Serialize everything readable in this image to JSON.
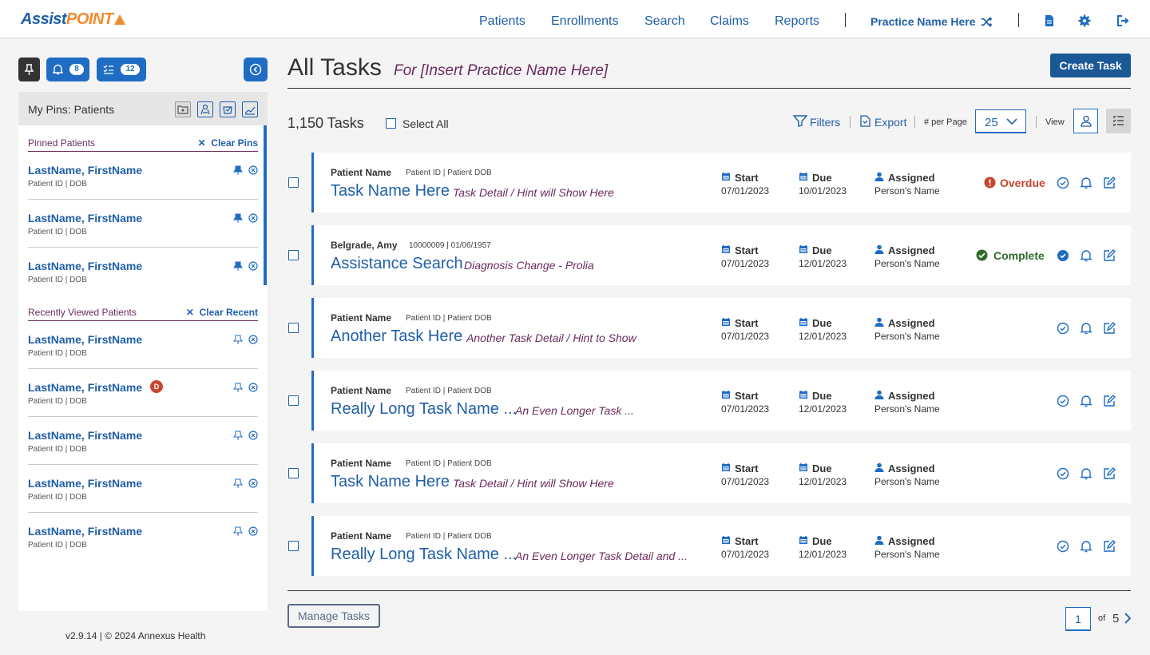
{
  "header": {
    "logo_left": "Assist",
    "logo_right": "POINT",
    "nav": [
      "Patients",
      "Enrollments",
      "Search",
      "Claims",
      "Reports"
    ],
    "practice": "Practice Name Here",
    "icons": [
      "document-icon",
      "gear-icon",
      "logout-icon"
    ]
  },
  "sidebar": {
    "notifications_count": "8",
    "tasks_count": "12",
    "panel_title": "My Pins: Patients",
    "pinned_label": "Pinned Patients",
    "clear_pins": "Clear Pins",
    "recent_label": "Recently Viewed Patients",
    "clear_recent": "Clear Recent",
    "pinned": [
      {
        "name": "LastName, FirstName",
        "sub": "Patient ID  |  DOB"
      },
      {
        "name": "LastName, FirstName",
        "sub": "Patient ID  |  DOB"
      },
      {
        "name": "LastName, FirstName",
        "sub": "Patient ID  |  DOB"
      }
    ],
    "recent": [
      {
        "name": "LastName, FirstName",
        "sub": "Patient ID  |  DOB"
      },
      {
        "name": "LastName, FirstName",
        "sub": "Patient ID  |  DOB",
        "badge": "D"
      },
      {
        "name": "LastName, FirstName",
        "sub": "Patient ID  |  DOB"
      },
      {
        "name": "LastName, FirstName",
        "sub": "Patient ID  |  DOB"
      },
      {
        "name": "LastName, FirstName",
        "sub": "Patient ID  |  DOB"
      }
    ],
    "footer": "v2.9.14  |  © 2024 Annexus Health"
  },
  "main": {
    "title": "All Tasks",
    "subtitle": "For [Insert Practice Name Here]",
    "create_button": "Create Task",
    "count": "1,150 Tasks",
    "select_all": "Select All",
    "filters": "Filters",
    "export": "Export",
    "per_page_label": "# per Page",
    "per_page_value": "25",
    "view_label": "View",
    "manage_button": "Manage Tasks",
    "page_current": "1",
    "page_of": "of",
    "page_total": "5",
    "columns": {
      "start": "Start",
      "due": "Due",
      "assigned": "Assigned"
    },
    "status_colors": {
      "overdue": "#c4472f",
      "complete": "#2e6b2a",
      "accent": "#1f6cc4"
    },
    "tasks": [
      {
        "patient": "Patient Name",
        "meta": "Patient ID  |  Patient DOB",
        "task": "Task Name Here",
        "hint": "Task Detail / Hint will Show Here",
        "start": "07/01/2023",
        "due": "10/01/2023",
        "assigned": "Person's Name",
        "status": "Overdue"
      },
      {
        "patient": "Belgrade, Amy",
        "meta": "10000009  |  01/06/1957",
        "task": "Assistance Search",
        "hint": "Diagnosis Change - Prolia",
        "start": "07/01/2023",
        "due": "12/01/2023",
        "assigned": "Person's Name",
        "status": "Complete"
      },
      {
        "patient": "Patient Name",
        "meta": "Patient ID  |  Patient DOB",
        "task": "Another Task Here",
        "hint": "Another Task Detail / Hint to Show",
        "start": "07/01/2023",
        "due": "12/01/2023",
        "assigned": "Person's Name",
        "status": ""
      },
      {
        "patient": "Patient Name",
        "meta": "Patient ID  |  Patient DOB",
        "task": "Really Long Task Name ...",
        "hint": "An Even Longer Task  ...",
        "start": "07/01/2023",
        "due": "12/01/2023",
        "assigned": "Person's Name",
        "status": ""
      },
      {
        "patient": "Patient Name",
        "meta": "Patient ID  |  Patient DOB",
        "task": "Task Name Here",
        "hint": "Task Detail / Hint will Show Here",
        "start": "07/01/2023",
        "due": "12/01/2023",
        "assigned": "Person's Name",
        "status": ""
      },
      {
        "patient": "Patient Name",
        "meta": "Patient ID  |  Patient DOB",
        "task": "Really Long Task Name ...",
        "hint": "An Even Longer Task Detail and  ...",
        "start": "07/01/2023",
        "due": "12/01/2023",
        "assigned": "Person's Name",
        "status": ""
      }
    ]
  }
}
